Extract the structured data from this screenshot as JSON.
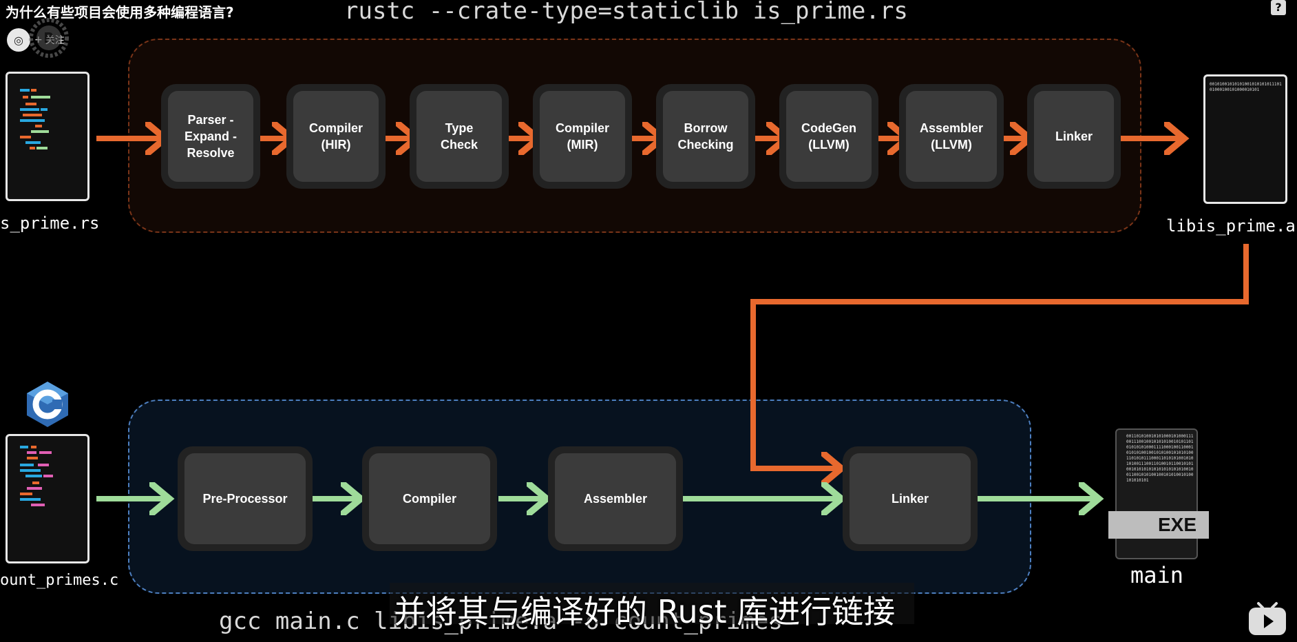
{
  "video": {
    "title": "为什么有些项目会使用多种编程语言?",
    "follow_label": "关注",
    "help": "?"
  },
  "commands": {
    "top": "rustc --crate-type=staticlib is_prime.rs",
    "bottom": "gcc main.c libis_prime.a -o count_primes"
  },
  "files": {
    "rust_source": "s_prime.rs",
    "c_source": "ount_primes.c",
    "static_lib": "libis_prime.a",
    "executable": "main",
    "executable_badge": "EXE",
    "static_lib_bits": "0010100101010100101010101110101000100101000010101",
    "exe_bits": "001101010010101000101000111001110010010101010010101101010101010001111000100110001010101001001010100101010100110101011100011010101001010101001110011010010110010101001010101010101010101010010011001010100100101010010100101010101"
  },
  "rust_pipeline": {
    "color": "#e8692e",
    "stages": [
      "Parser -\nExpand -\nResolve",
      "Compiler\n(HIR)",
      "Type\nCheck",
      "Compiler\n(MIR)",
      "Borrow\nChecking",
      "CodeGen\n(LLVM)",
      "Assembler\n(LLVM)",
      "Linker"
    ]
  },
  "c_pipeline": {
    "color": "#9fdc9a",
    "stages": [
      "Pre-Processor",
      "Compiler",
      "Assembler",
      "Linker"
    ]
  },
  "subtitle": "并将其与编译好的 Rust 库进行链接"
}
